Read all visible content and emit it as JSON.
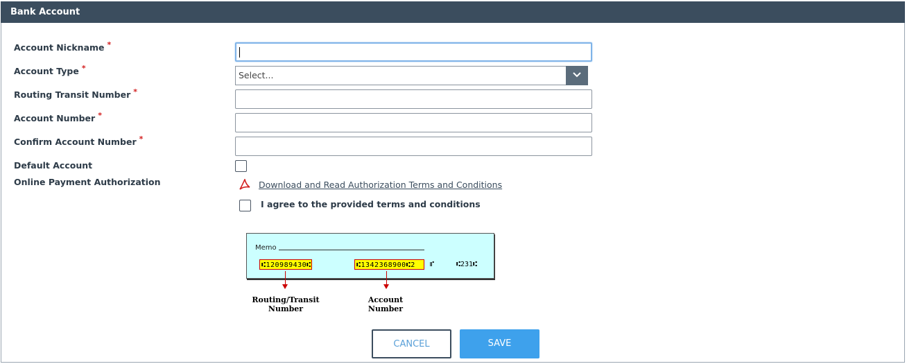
{
  "header": {
    "title": "Bank Account"
  },
  "form": {
    "required_mark": "*",
    "nickname": {
      "label": "Account Nickname",
      "value": ""
    },
    "account_type": {
      "label": "Account Type",
      "selected": "Select..."
    },
    "routing": {
      "label": "Routing Transit Number",
      "value": ""
    },
    "account_number": {
      "label": "Account Number",
      "value": ""
    },
    "confirm_account": {
      "label": "Confirm Account Number",
      "value": ""
    },
    "default_account": {
      "label": "Default Account",
      "checked": false
    },
    "authorization": {
      "label": "Online Payment Authorization",
      "link_text": "Download and Read Authorization Terms and Conditions",
      "agree_text": "I agree to the provided terms and conditions",
      "agree_checked": false
    }
  },
  "check_image": {
    "memo": "Memo",
    "routing_digits": "⑆120989430⑆",
    "account_digits": "⑆1342368900⑆2",
    "extra_mark": "⑈",
    "check_no": "⑆231⑆",
    "routing_caption": "Routing/Transit Number",
    "account_caption": "Account Number"
  },
  "buttons": {
    "cancel": "CANCEL",
    "save": "SAVE"
  },
  "colors": {
    "header_bg": "#3b4d5e",
    "save_bg": "#3ea1ec",
    "required": "#d32020"
  },
  "icons": {
    "pdf": "pdf-icon",
    "dropdown": "chevron-down-icon"
  }
}
